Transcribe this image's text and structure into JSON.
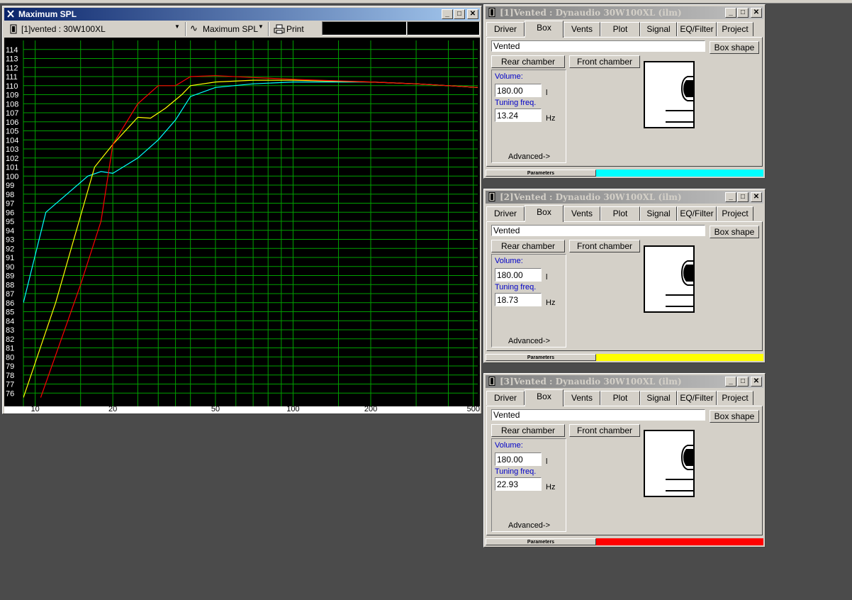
{
  "spl_window": {
    "title": "Maximum SPL",
    "project_select": "[1]vented : 30W100XL",
    "plot_select": "Maximum SPL",
    "print_label": "Print"
  },
  "chart_data": {
    "type": "line",
    "x_scale": "log",
    "xlim": [
      9,
      520
    ],
    "ylim": [
      75,
      115
    ],
    "x_tick_labels": [
      "10",
      "20",
      "50",
      "100",
      "200",
      "500"
    ],
    "x_ticks": [
      10,
      20,
      50,
      100,
      200,
      500
    ],
    "x_grid": [
      10,
      15,
      20,
      25,
      30,
      35,
      40,
      50,
      60,
      70,
      80,
      90,
      100,
      150,
      200,
      300,
      400,
      500
    ],
    "y_tick_labels": [
      "114",
      "113",
      "112",
      "111",
      "110",
      "109",
      "108",
      "107",
      "106",
      "105",
      "104",
      "103",
      "102",
      "101",
      "100",
      "99",
      "98",
      "97",
      "96",
      "95",
      "94",
      "93",
      "92",
      "91",
      "90",
      "89",
      "88",
      "87",
      "86",
      "85",
      "84",
      "83",
      "82",
      "81",
      "80",
      "79",
      "78",
      "77",
      "76"
    ],
    "background": "#000000",
    "grid_color": "#00a000",
    "series": [
      {
        "color": "#00ffff",
        "points": [
          [
            9,
            86
          ],
          [
            11,
            96
          ],
          [
            16,
            100
          ],
          [
            18,
            100.5
          ],
          [
            20,
            100.3
          ],
          [
            25,
            102
          ],
          [
            30,
            104
          ],
          [
            35,
            106.2
          ],
          [
            40,
            108.8
          ],
          [
            50,
            109.8
          ],
          [
            70,
            110.2
          ],
          [
            100,
            110.4
          ],
          [
            200,
            110.4
          ],
          [
            300,
            110.2
          ],
          [
            400,
            110
          ],
          [
            520,
            109.8
          ]
        ]
      },
      {
        "color": "#ffff00",
        "points": [
          [
            9,
            75.5
          ],
          [
            12,
            86
          ],
          [
            17,
            101
          ],
          [
            20,
            103.5
          ],
          [
            25,
            106.5
          ],
          [
            28,
            106.4
          ],
          [
            32,
            107.5
          ],
          [
            37,
            109
          ],
          [
            40,
            110
          ],
          [
            50,
            110.4
          ],
          [
            70,
            110.6
          ],
          [
            100,
            110.6
          ],
          [
            200,
            110.4
          ],
          [
            300,
            110.2
          ],
          [
            400,
            110
          ],
          [
            520,
            109.8
          ]
        ]
      },
      {
        "color": "#ff0000",
        "points": [
          [
            10.5,
            75.5
          ],
          [
            15,
            88
          ],
          [
            18,
            95
          ],
          [
            20,
            103.5
          ],
          [
            25,
            108
          ],
          [
            30,
            110
          ],
          [
            35,
            110
          ],
          [
            40,
            111
          ],
          [
            50,
            111.1
          ],
          [
            70,
            110.9
          ],
          [
            100,
            110.7
          ],
          [
            200,
            110.4
          ],
          [
            300,
            110.2
          ],
          [
            400,
            110
          ],
          [
            520,
            109.8
          ]
        ]
      }
    ]
  },
  "box_windows": [
    {
      "title": "[1]Vented : Dynaudio 30W100XL (ilm)",
      "tabs": [
        "Driver",
        "Box",
        "Vents",
        "Plot",
        "Signal",
        "EQ/Filter",
        "Project"
      ],
      "selected_tab": "Box",
      "box_type": "Vented",
      "box_shape_label": "Box shape",
      "rear_chamber_label": "Rear chamber",
      "front_chamber_label": "Front chamber",
      "volume_label": "Volume:",
      "volume_value": "180.00",
      "volume_unit": "l",
      "tuning_label": "Tuning freq.",
      "tuning_value": "13.24",
      "tuning_unit": "Hz",
      "advanced_label": "Advanced->",
      "parameters_label": "Parameters",
      "status_color": "#00ffff"
    },
    {
      "title": "[2]Vented : Dynaudio 30W100XL (ilm)",
      "tabs": [
        "Driver",
        "Box",
        "Vents",
        "Plot",
        "Signal",
        "EQ/Filter",
        "Project"
      ],
      "selected_tab": "Box",
      "box_type": "Vented",
      "box_shape_label": "Box shape",
      "rear_chamber_label": "Rear chamber",
      "front_chamber_label": "Front chamber",
      "volume_label": "Volume:",
      "volume_value": "180.00",
      "volume_unit": "l",
      "tuning_label": "Tuning freq.",
      "tuning_value": "18.73",
      "tuning_unit": "Hz",
      "advanced_label": "Advanced->",
      "parameters_label": "Parameters",
      "status_color": "#ffff00"
    },
    {
      "title": "[3]Vented : Dynaudio 30W100XL (ilm)",
      "tabs": [
        "Driver",
        "Box",
        "Vents",
        "Plot",
        "Signal",
        "EQ/Filter",
        "Project"
      ],
      "selected_tab": "Box",
      "box_type": "Vented",
      "box_shape_label": "Box shape",
      "rear_chamber_label": "Rear chamber",
      "front_chamber_label": "Front chamber",
      "volume_label": "Volume:",
      "volume_value": "180.00",
      "volume_unit": "l",
      "tuning_label": "Tuning freq.",
      "tuning_value": "22.93",
      "tuning_unit": "Hz",
      "advanced_label": "Advanced->",
      "parameters_label": "Parameters",
      "status_color": "#ff0000"
    }
  ]
}
